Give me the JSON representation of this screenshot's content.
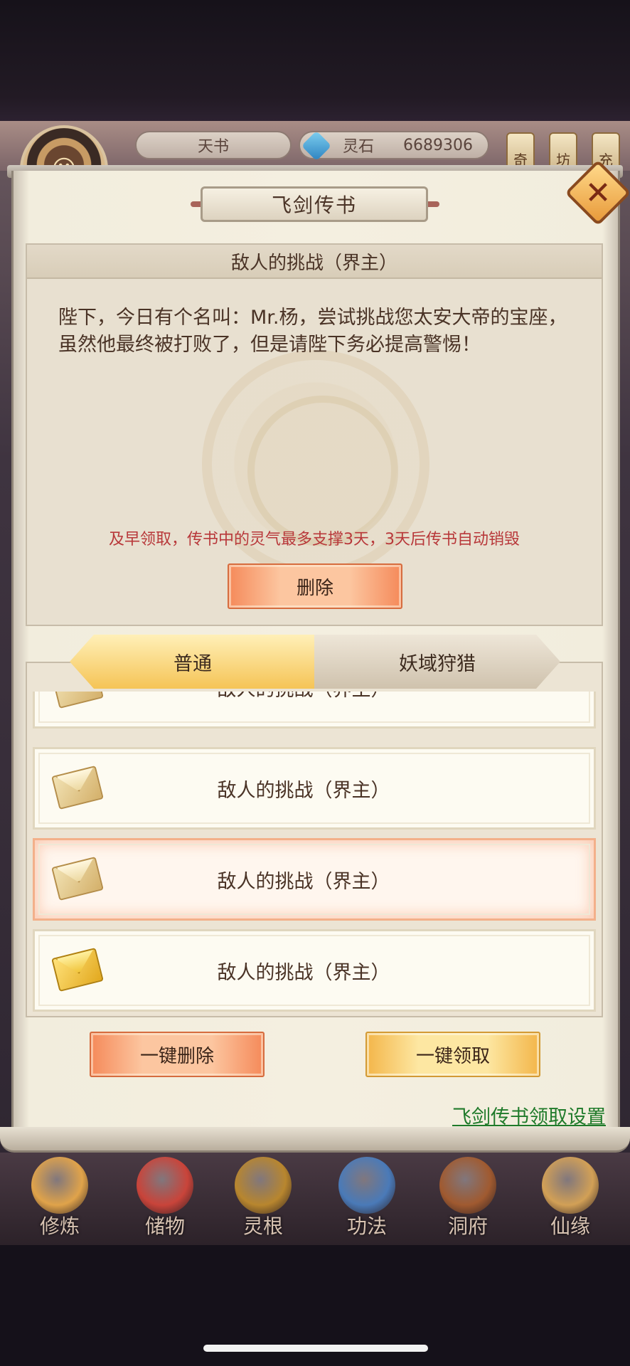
{
  "topbar": {
    "book_label": "天书",
    "stone_label": "灵石",
    "stone_value": "6689306",
    "side_tabs": [
      "奇",
      "坊",
      "充"
    ]
  },
  "modal": {
    "title": "飞剑传书",
    "close_label": "✕",
    "letter": {
      "subject": "敌人的挑战（界主）",
      "body": "陛下，今日有个名叫：Mr.杨，尝试挑战您太安大帝的宝座，虽然他最终被打败了，但是请陛下务必提高警惕！",
      "warning": "及早领取，传书中的灵气最多支撑3天，3天后传书自动销毁",
      "delete_label": "删除"
    },
    "tabs": [
      {
        "label": "普通",
        "active": true
      },
      {
        "label": "妖域狩猎",
        "active": false
      }
    ],
    "items": [
      {
        "label": "敌人的挑战（界主）",
        "state": "opened"
      },
      {
        "label": "敌人的挑战（界主）",
        "state": "opened"
      },
      {
        "label": "敌人的挑战（界主）",
        "state": "opened",
        "selected": true
      },
      {
        "label": "敌人的挑战（界主）",
        "state": "unread"
      }
    ],
    "delete_all_label": "一键删除",
    "claim_all_label": "一键领取",
    "settings_link": "飞剑传书领取设置"
  },
  "bottom_nav": [
    {
      "label": "修炼",
      "icon": "cultivator-icon",
      "color": "#e0a34a"
    },
    {
      "label": "储物",
      "icon": "bag-icon",
      "color": "#c9443a"
    },
    {
      "label": "灵根",
      "icon": "spirit-root-icon",
      "color": "#b8862e"
    },
    {
      "label": "功法",
      "icon": "scroll-book-icon",
      "color": "#4a7ab8"
    },
    {
      "label": "洞府",
      "icon": "cave-house-icon",
      "color": "#a05a30"
    },
    {
      "label": "仙缘",
      "icon": "gourd-icon",
      "color": "#d2a056"
    }
  ],
  "colors": {
    "warning": "#b8383a",
    "link": "#1f7a2a",
    "button_orange": "#f58a5a",
    "button_gold": "#f3b64a"
  }
}
